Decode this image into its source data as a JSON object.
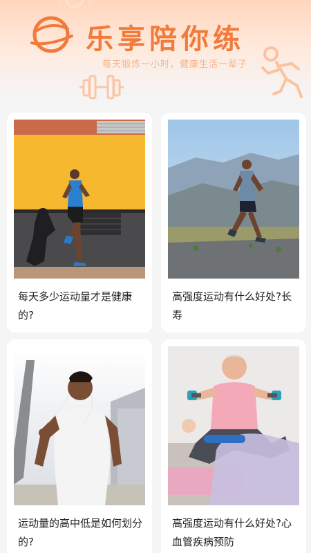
{
  "header": {
    "app_title": "乐享陪你练",
    "slogan": "每天锻炼一小时，健康生活一辈子",
    "brand_color": "#f27a3a"
  },
  "articles": [
    {
      "title": "每天多少运动量才是健康的?",
      "image": "runner-by-yellow-wall"
    },
    {
      "title": "高强度运动有什么好处?长寿",
      "image": "runner-on-mountain-road"
    },
    {
      "title": "运动量的高中低是如何划分的?",
      "image": "man-with-earphones-running"
    },
    {
      "title": "高强度运动有什么好处?心血管疾病预防",
      "image": "senior-man-lifting-dumbbells"
    }
  ]
}
